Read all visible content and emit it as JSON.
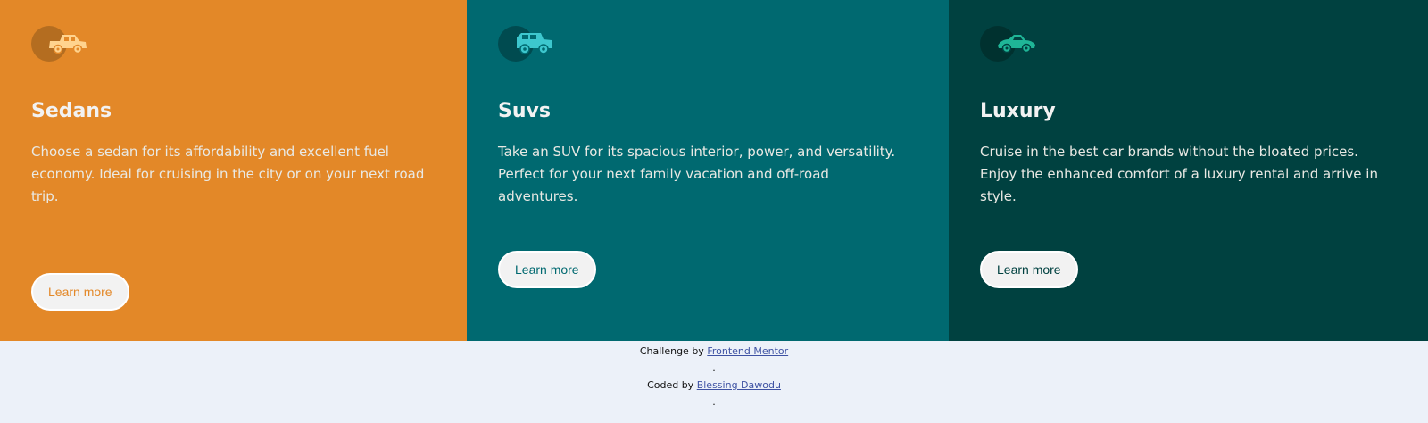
{
  "cards": [
    {
      "title": "Sedans",
      "description": "Choose a sedan for its affordability and excellent fuel economy. Ideal for cruising in the city or on your next road trip.",
      "button_label": "Learn more",
      "icon": "sedan-icon",
      "background": "#e38828",
      "icon_color": "#ffd38e"
    },
    {
      "title": "Suvs",
      "description": "Take an SUV for its spacious interior, power, and versatility. Perfect for your next family vacation and off-road adventures.",
      "button_label": "Learn more",
      "icon": "suv-icon",
      "background": "#006970",
      "icon_color": "#3dc7ce"
    },
    {
      "title": "Luxury",
      "description": "Cruise in the best car brands without the bloated prices. Enjoy the enhanced comfort of a luxury rental and arrive in style.",
      "button_label": "Learn more",
      "icon": "luxury-car-icon",
      "background": "#004140",
      "icon_color": "#1fb597"
    }
  ],
  "attribution": {
    "challenge_prefix": "Challenge by",
    "challenge_link": "Frontend Mentor",
    "separator_1": ".",
    "coded_prefix": "Coded by",
    "coded_link": "Blessing Dawodu",
    "separator_2": "."
  },
  "colors": {
    "page_background": "#ecf1f9",
    "button_background": "#f2f2f2",
    "heading_text": "#f2f2f2",
    "link": "#3e52a3"
  }
}
